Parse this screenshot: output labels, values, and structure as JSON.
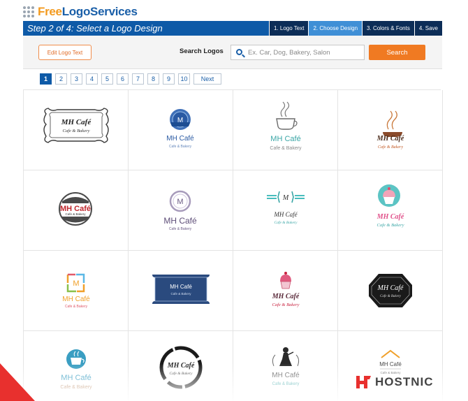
{
  "brand": {
    "part1": "Free",
    "part2": "LogoServices"
  },
  "stepbar": {
    "title": "Step 2 of 4: Select a Logo Design",
    "steps": [
      "1. Logo Text",
      "2. Choose Design",
      "3. Colors & Fonts",
      "4. Save"
    ],
    "active_index": 1
  },
  "toolbar": {
    "edit_label": "Edit Logo Text",
    "search_label": "Search Logos",
    "search_placeholder": "Ex. Car, Dog, Bakery, Salon",
    "search_value": "",
    "search_button": "Search"
  },
  "pagination": {
    "pages": [
      "1",
      "2",
      "3",
      "4",
      "5",
      "6",
      "7",
      "8",
      "9",
      "10"
    ],
    "active": "1",
    "next": "Next"
  },
  "logo_text": {
    "name": "MH Café",
    "tagline": "Cafe & Bakery",
    "monogram": "M"
  },
  "logos": [
    {
      "style": "ornate-frame"
    },
    {
      "style": "blue-seal"
    },
    {
      "style": "steaming-cup"
    },
    {
      "style": "script-coffee"
    },
    {
      "style": "red-circle-badge"
    },
    {
      "style": "purple-ring"
    },
    {
      "style": "teal-lines"
    },
    {
      "style": "cupcake"
    },
    {
      "style": "color-square"
    },
    {
      "style": "navy-label"
    },
    {
      "style": "cupcake-script"
    },
    {
      "style": "black-hexagon"
    },
    {
      "style": "coffee-cup-icon"
    },
    {
      "style": "brush-circle"
    },
    {
      "style": "lady-silhouette"
    },
    {
      "style": "orange-roof"
    }
  ],
  "colors": {
    "primary": "#0e5aa7",
    "accent": "#f07a22",
    "dark_step": "#0c2d57",
    "active_step": "#3f8fd6"
  },
  "watermark": {
    "text": "HOSTNIC"
  }
}
